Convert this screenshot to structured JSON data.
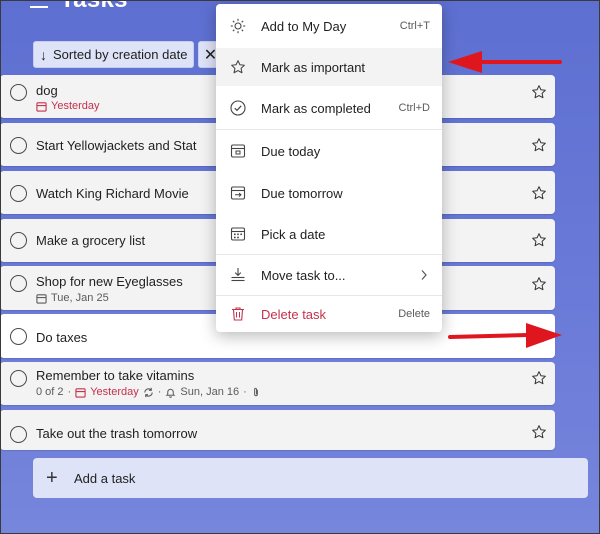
{
  "header": {
    "title": "Tasks",
    "menu_icon": "hamburger-icon"
  },
  "sort": {
    "label": "Sorted by creation date",
    "arrow": "↓",
    "clear": "✕"
  },
  "tasks": [
    {
      "name": "dog",
      "due": "Yesterday"
    },
    {
      "name": "Start Yellowjackets and Stat"
    },
    {
      "name": "Watch King Richard Movie"
    },
    {
      "name": "Make a grocery list"
    },
    {
      "name": "Shop for new Eyeglasses",
      "due": "Tue, Jan 25"
    },
    {
      "name": "Do taxes"
    },
    {
      "name": "Remember to take vitamins",
      "steps": "0 of 2",
      "due": "Yesterday",
      "reminder": "Sun, Jan 16"
    },
    {
      "name": "Take out the trash tomorrow"
    }
  ],
  "add_task": {
    "label": "Add a task",
    "plus": "+"
  },
  "context_menu": {
    "items": [
      {
        "label": "Add to My Day",
        "shortcut": "Ctrl+T",
        "icon": "sun-icon"
      },
      {
        "label": "Mark as important",
        "shortcut": "",
        "icon": "star-icon"
      },
      {
        "label": "Mark as completed",
        "shortcut": "Ctrl+D",
        "icon": "check-circle-icon"
      },
      {
        "label": "Due today",
        "shortcut": "",
        "icon": "calendar-today-icon"
      },
      {
        "label": "Due tomorrow",
        "shortcut": "",
        "icon": "calendar-next-icon"
      },
      {
        "label": "Pick a date",
        "shortcut": "",
        "icon": "calendar-grid-icon"
      },
      {
        "label": "Move task to...",
        "shortcut": "",
        "icon": "move-task-icon"
      },
      {
        "label": "Delete task",
        "shortcut": "Delete",
        "icon": "trash-icon"
      }
    ]
  },
  "colors": {
    "accent": "#5d6fd1",
    "danger": "#c4314b",
    "annotation": "#e0161e"
  }
}
